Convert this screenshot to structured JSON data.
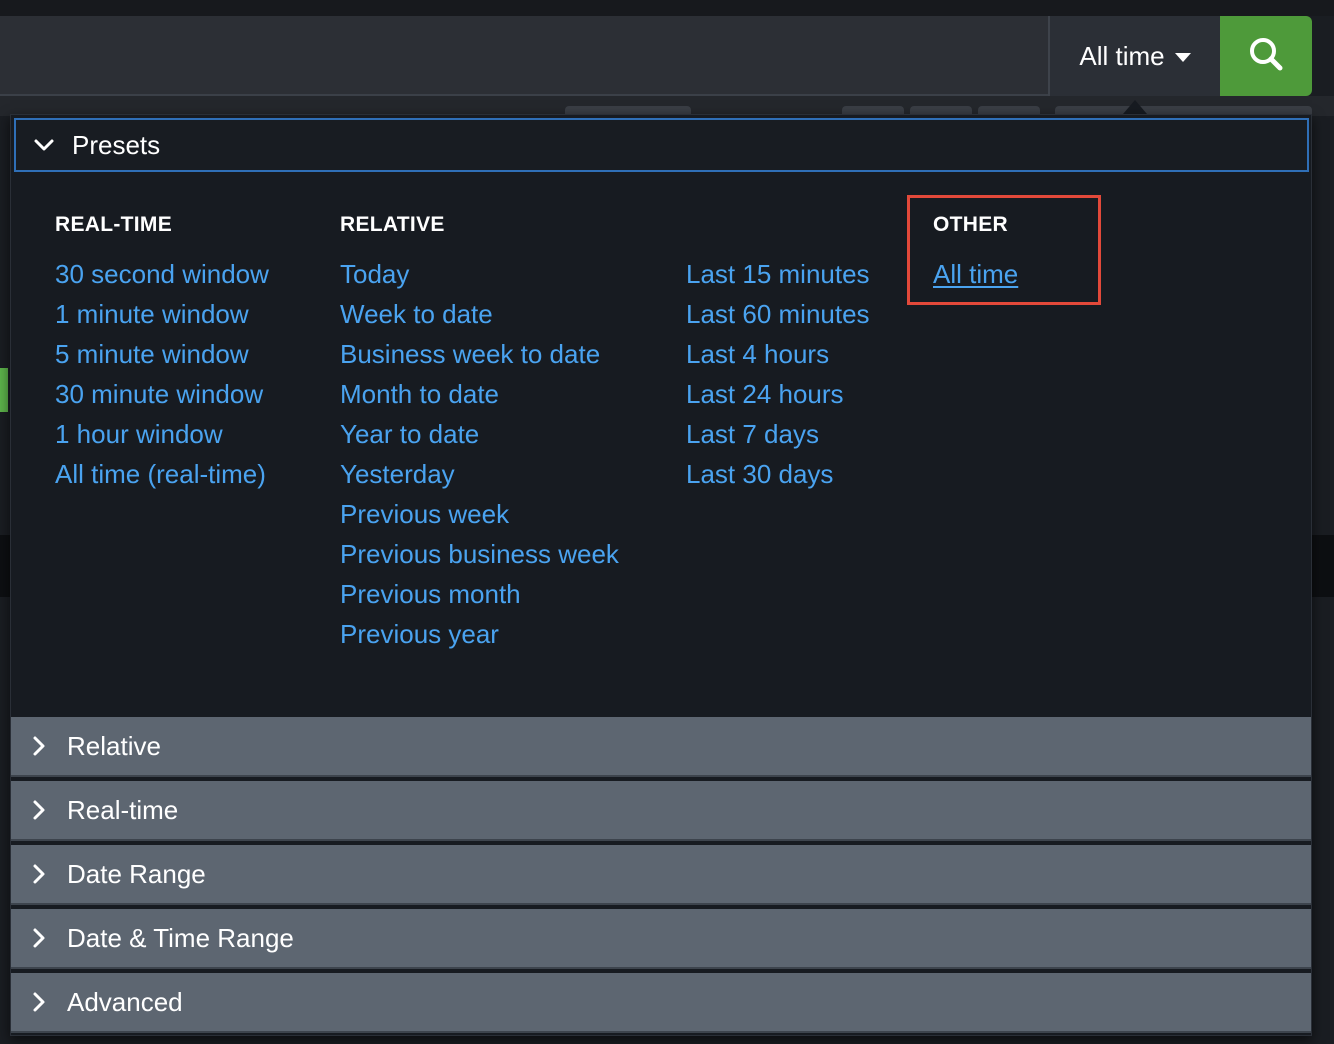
{
  "toolbar": {
    "time_range_label": "All time",
    "search_icon": "search-icon"
  },
  "presets": {
    "header_label": "Presets",
    "columns": {
      "realtime": {
        "title": "REAL-TIME",
        "items": [
          "30 second window",
          "1 minute window",
          "5 minute window",
          "30 minute window",
          "1 hour window",
          "All time (real-time)"
        ]
      },
      "relative": {
        "title": "RELATIVE",
        "items": [
          "Today",
          "Week to date",
          "Business week to date",
          "Month to date",
          "Year to date",
          "Yesterday",
          "Previous week",
          "Previous business week",
          "Previous month",
          "Previous year"
        ]
      },
      "relative_last": {
        "items": [
          "Last 15 minutes",
          "Last 60 minutes",
          "Last 4 hours",
          "Last 24 hours",
          "Last 7 days",
          "Last 30 days"
        ]
      },
      "other": {
        "title": "OTHER",
        "items": [
          "All time"
        ],
        "selected": "All time"
      }
    }
  },
  "accordion": [
    {
      "label": "Relative"
    },
    {
      "label": "Real-time"
    },
    {
      "label": "Date Range"
    },
    {
      "label": "Date & Time Range"
    },
    {
      "label": "Advanced"
    }
  ],
  "colors": {
    "link": "#4aa3f0",
    "highlight_box": "#e2493a",
    "search_button": "#4e9a3a",
    "focus_border": "#2f6fb7"
  }
}
